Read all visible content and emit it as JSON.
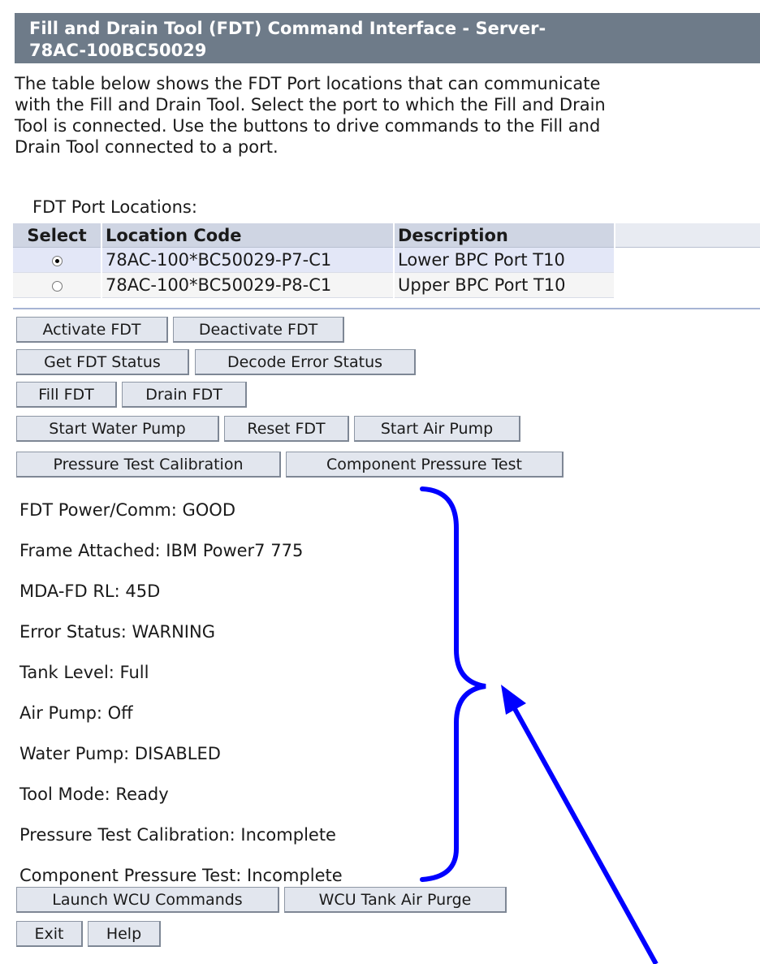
{
  "header": {
    "title_line1": "Fill and Drain Tool (FDT) Command Interface - Server-",
    "title_line2": "78AC-100BC50029"
  },
  "intro": {
    "lines": [
      "The table below shows the FDT Port locations that can communicate",
      "with the Fill and Drain Tool. Select the port to which the Fill and Drain",
      "Tool is connected. Use the buttons to drive commands to the Fill and",
      "Drain Tool connected to a port."
    ]
  },
  "ports": {
    "label": "FDT Port Locations:",
    "columns": [
      "Select",
      "Location Code",
      "Description"
    ],
    "rows": [
      {
        "selected": true,
        "location": "78AC-100*BC50029-P7-C1",
        "description": "Lower BPC Port T10"
      },
      {
        "selected": false,
        "location": "78AC-100*BC50029-P8-C1",
        "description": "Upper BPC Port T10"
      }
    ]
  },
  "buttons": {
    "activate": "Activate FDT",
    "deactivate": "Deactivate FDT",
    "get_status": "Get FDT Status",
    "decode_error": "Decode Error Status",
    "fill": "Fill FDT",
    "drain": "Drain FDT",
    "start_water_pump": "Start Water Pump",
    "reset": "Reset FDT",
    "start_air_pump": "Start Air Pump",
    "pressure_calibration": "Pressure Test Calibration",
    "component_pressure_test": "Component Pressure Test",
    "launch_wcu": "Launch WCU Commands",
    "wcu_air_purge": "WCU Tank Air Purge",
    "exit": "Exit",
    "help": "Help"
  },
  "status": [
    "FDT Power/Comm: GOOD",
    "Frame Attached: IBM Power7 775",
    "MDA-FD RL: 45D",
    "Error Status: WARNING",
    "Tank Level: Full",
    "Air Pump: Off",
    "Water Pump: DISABLED",
    "Tool Mode: Ready",
    "Pressure Test Calibration: Incomplete",
    "Component Pressure Test: Incomplete"
  ],
  "colors": {
    "title_bar": "#6e7b89",
    "annotation": "#0000ff",
    "table_header": "#cfd5e3"
  }
}
